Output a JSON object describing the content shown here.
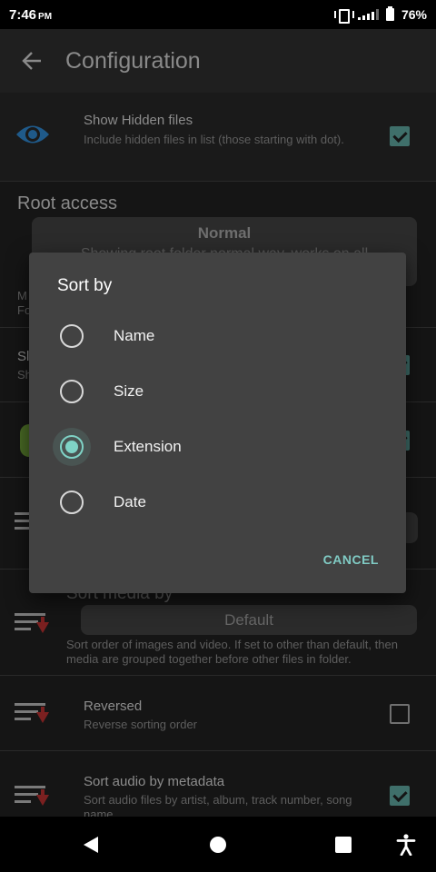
{
  "status": {
    "time": "7:46",
    "ampm": "PM",
    "battery": "76%"
  },
  "appbar": {
    "title": "Configuration"
  },
  "settings": {
    "hidden_files": {
      "title": "Show Hidden files",
      "subtitle": "Include hidden files in list (those starting with dot).",
      "checked": true
    },
    "root_section": "Root access",
    "root_mode": {
      "value": "Normal",
      "description": "Showing root folder normal way, works on all"
    },
    "partial_left_1": "M",
    "partial_left_2": "Fo",
    "partial_left_3": "Sl",
    "partial_left_4": "Sh",
    "sort_media": {
      "title": "Sort media by",
      "value": "Default",
      "subtitle": "Sort order of images and video. If set to other than default, then media are grouped together before other files in folder."
    },
    "reversed": {
      "title": "Reversed",
      "subtitle": "Reverse sorting order",
      "checked": false
    },
    "sort_audio": {
      "title": "Sort audio by metadata",
      "subtitle": "Sort audio files by artist, album, track number, song name",
      "checked": true
    }
  },
  "dialog": {
    "title": "Sort by",
    "options": [
      {
        "label": "Name",
        "selected": false
      },
      {
        "label": "Size",
        "selected": false
      },
      {
        "label": "Extension",
        "selected": true
      },
      {
        "label": "Date",
        "selected": false
      }
    ],
    "cancel": "CANCEL"
  },
  "colors": {
    "accent": "#80cbc4",
    "dialog_bg": "#424242"
  }
}
